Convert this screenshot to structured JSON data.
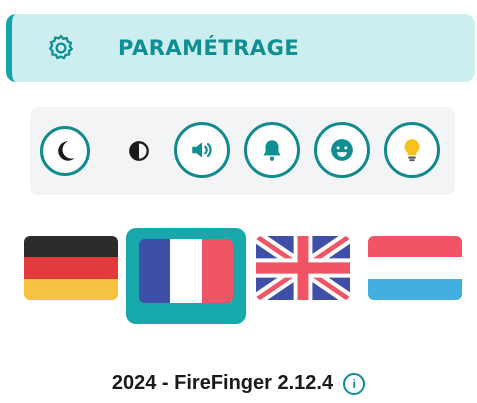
{
  "header": {
    "title": "PARAMÉTRAGE",
    "icon": "gear-icon"
  },
  "toolbar": {
    "items": [
      {
        "name": "dark-mode-toggle",
        "icon": "moon-icon"
      },
      {
        "name": "contrast-toggle",
        "icon": "contrast-icon"
      },
      {
        "name": "sound-toggle",
        "icon": "volume-icon"
      },
      {
        "name": "notifications-toggle",
        "icon": "bell-icon"
      },
      {
        "name": "emoji-toggle",
        "icon": "smiley-icon"
      },
      {
        "name": "hints-toggle",
        "icon": "lightbulb-icon"
      }
    ]
  },
  "languages": {
    "selected": "fr",
    "items": [
      {
        "code": "de",
        "icon": "flag-germany-icon"
      },
      {
        "code": "fr",
        "icon": "flag-france-icon"
      },
      {
        "code": "en",
        "icon": "flag-uk-icon"
      },
      {
        "code": "lu",
        "icon": "flag-luxembourg-icon"
      }
    ]
  },
  "footer": {
    "text": "2024 - FireFinger 2.12.4",
    "info_icon": "info-icon"
  },
  "colors": {
    "accent": "#108a8f",
    "header_bg": "#cdeeee",
    "selected_bg": "#17a8ab"
  }
}
